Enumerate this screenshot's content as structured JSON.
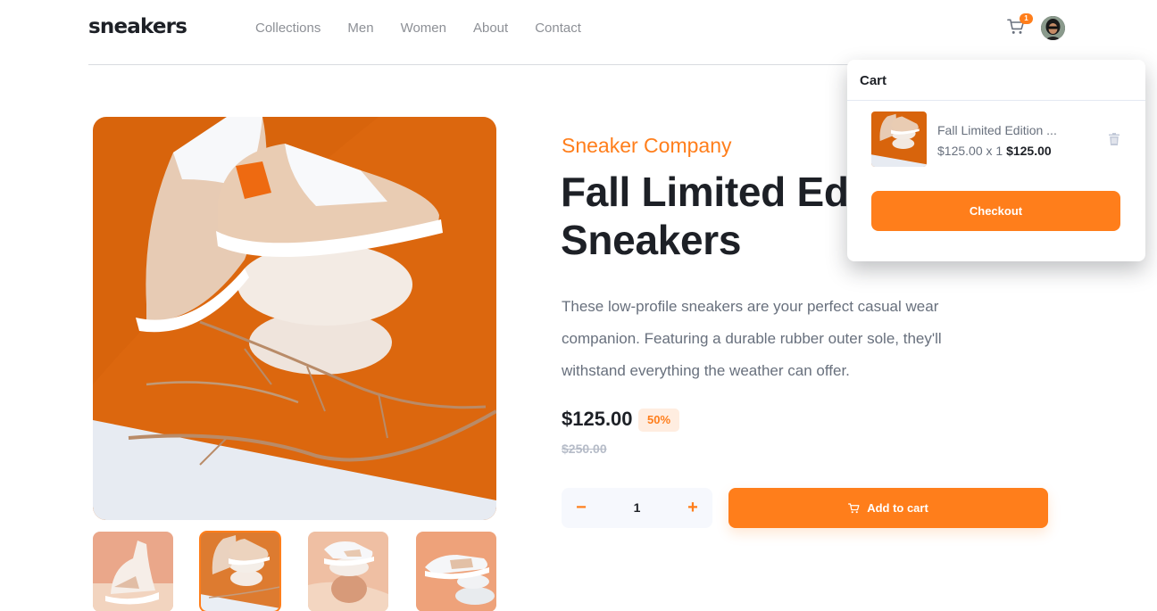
{
  "header": {
    "logo": "sneakers",
    "nav": [
      "Collections",
      "Men",
      "Women",
      "About",
      "Contact"
    ],
    "cart_count": "1",
    "cart_icon": "cart-icon",
    "avatar_icon": "avatar-image"
  },
  "product": {
    "company": "Sneaker Company",
    "title": "Fall Limited Edition Sneakers",
    "description": "These low-profile sneakers are your perfect casual wear companion. Featuring a durable rubber outer sole, they'll withstand everything the weather can offer.",
    "price": "$125.00",
    "discount": "50%",
    "old_price": "$250.00",
    "quantity": "1",
    "minus_label": "−",
    "plus_label": "+",
    "add_to_cart_label": "Add to cart",
    "thumbnails": [
      "thumbnail-1",
      "thumbnail-2",
      "thumbnail-3",
      "thumbnail-4"
    ],
    "active_thumbnail": 2
  },
  "cart": {
    "title": "Cart",
    "item_name": "Fall Limited Edition ...",
    "item_calc": "$125.00 x 1",
    "item_total": "$125.00",
    "checkout_label": "Checkout",
    "trash_icon": "trash-icon"
  },
  "colors": {
    "accent": "#ff7e1b",
    "accent_pale": "#ffede0",
    "text_dark": "#1d2026",
    "text_muted": "#68707d",
    "text_light": "#b6bcc8"
  }
}
